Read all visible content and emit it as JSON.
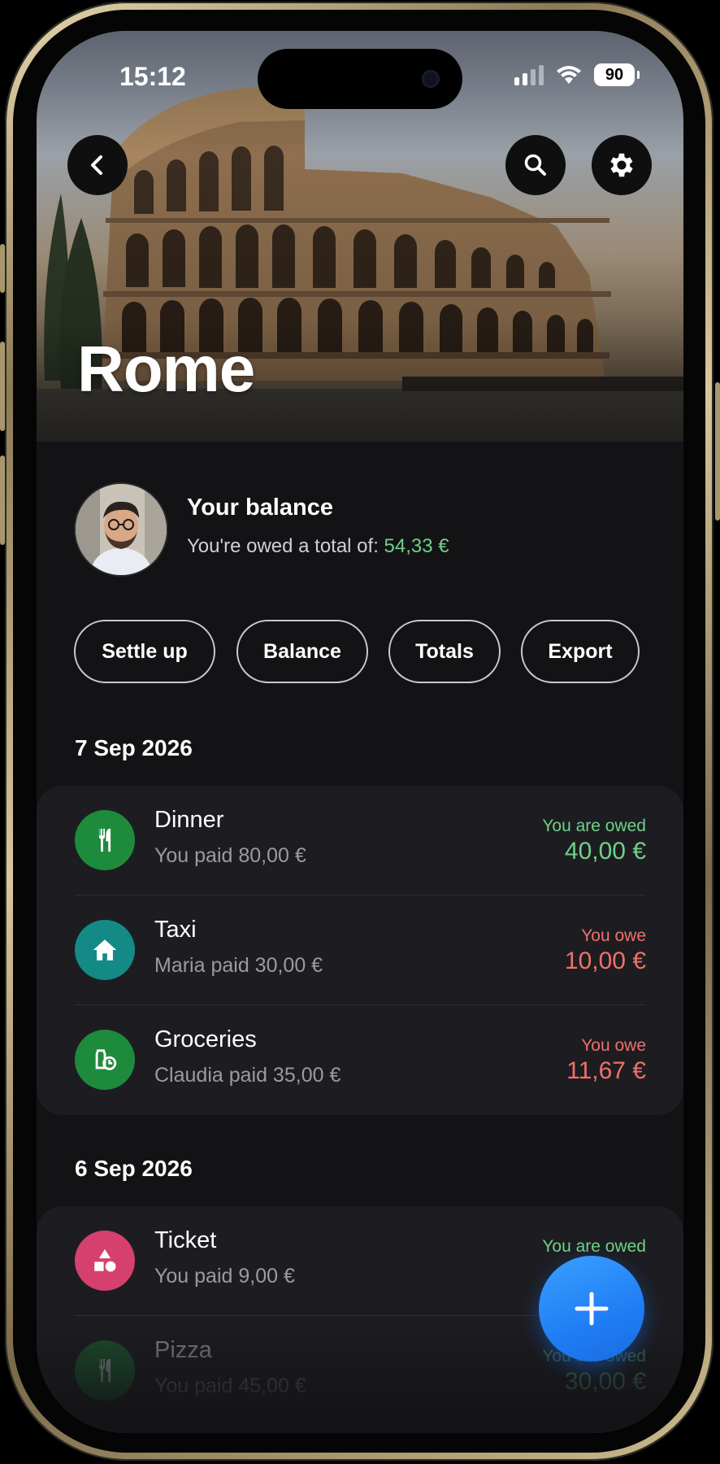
{
  "status_bar": {
    "time": "15:12",
    "battery": "90"
  },
  "header": {
    "title": "Rome"
  },
  "balance": {
    "title": "Your balance",
    "subtitle_prefix": "You're owed a total of: ",
    "amount": "54,33 €"
  },
  "actions": [
    {
      "label": "Settle up"
    },
    {
      "label": "Balance"
    },
    {
      "label": "Totals"
    },
    {
      "label": "Export"
    }
  ],
  "sections": [
    {
      "date": "7 Sep 2026",
      "items": [
        {
          "title": "Dinner",
          "subtitle": "You paid 80,00 €",
          "status": "You are owed",
          "amount": "40,00 €",
          "icon": "fork-knife-icon",
          "icon_color": "#1e8b3c",
          "tone": "positive"
        },
        {
          "title": "Taxi",
          "subtitle": "Maria paid 30,00 €",
          "status": "You owe",
          "amount": "10,00 €",
          "icon": "home-icon",
          "icon_color": "#138a86",
          "tone": "negative"
        },
        {
          "title": "Groceries",
          "subtitle": "Claudia paid 35,00 €",
          "status": "You owe",
          "amount": "11,67 €",
          "icon": "groceries-icon",
          "icon_color": "#1e8b3c",
          "tone": "negative"
        }
      ]
    },
    {
      "date": "6 Sep 2026",
      "items": [
        {
          "title": "Ticket",
          "subtitle": "You paid 9,00 €",
          "status": "You are owed",
          "amount": "",
          "icon": "shapes-icon",
          "icon_color": "#d6406f",
          "tone": "positive"
        },
        {
          "title": "Pizza",
          "subtitle": "You paid 45,00 €",
          "status": "You are owed",
          "amount": "30,00 €",
          "icon": "fork-knife-icon",
          "icon_color": "#1e8b3c",
          "tone": "positive"
        }
      ]
    }
  ],
  "colors": {
    "positive": "#6fd189",
    "negative": "#f0706a",
    "fab": "#1f7ef5"
  }
}
